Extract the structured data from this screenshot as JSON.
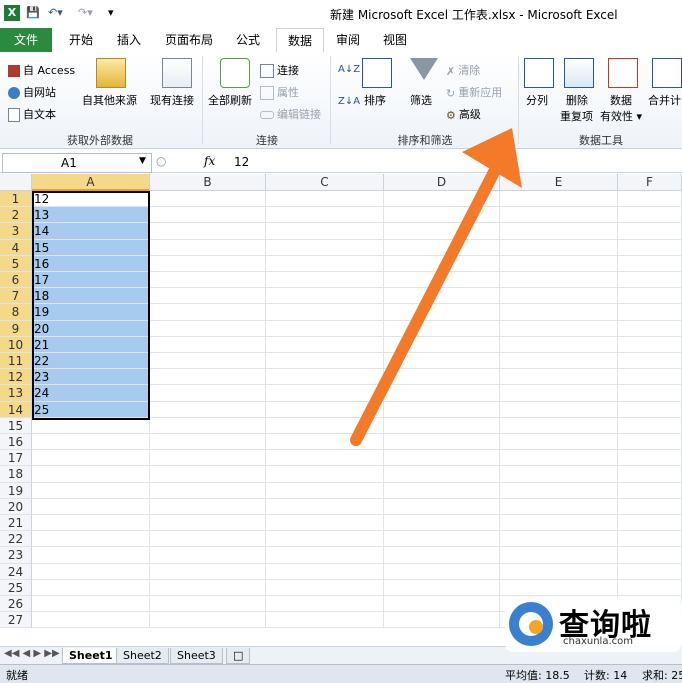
{
  "window": {
    "title": "新建 Microsoft Excel 工作表.xlsx - Microsoft Excel",
    "app_logo": "X"
  },
  "tabs": [
    {
      "label": "文件"
    },
    {
      "label": "开始"
    },
    {
      "label": "插入"
    },
    {
      "label": "页面布局"
    },
    {
      "label": "公式"
    },
    {
      "label": "数据"
    },
    {
      "label": "审阅"
    },
    {
      "label": "视图"
    }
  ],
  "ribbon": {
    "external": {
      "access": "自 Access",
      "web": "自网站",
      "text": "自文本",
      "other": "自其他来源",
      "existing": "现有连接",
      "group": "获取外部数据"
    },
    "connections": {
      "refresh": "全部刷新",
      "connect": "连接",
      "properties": "属性",
      "edit_links": "编辑链接",
      "group": "连接"
    },
    "sort": {
      "sort": "排序",
      "filter": "筛选",
      "clear": "清除",
      "reapply": "重新应用",
      "advanced": "高级",
      "group": "排序和筛选"
    },
    "tools": {
      "split": "分列",
      "remove_dup_1": "删除",
      "remove_dup_2": "重复项",
      "validation_1": "数据",
      "validation_2": "有效性",
      "consolidate": "合并计",
      "group": "数据工具"
    }
  },
  "formula_bar": {
    "name_box": "A1",
    "fx": "fx",
    "value": "12"
  },
  "columns": [
    "A",
    "B",
    "C",
    "D",
    "E",
    "F"
  ],
  "rows": [
    "1",
    "2",
    "3",
    "4",
    "5",
    "6",
    "7",
    "8",
    "9",
    "10",
    "11",
    "12",
    "13",
    "14",
    "15",
    "16",
    "17",
    "18",
    "19",
    "20",
    "21",
    "22",
    "23",
    "24",
    "25",
    "26",
    "27"
  ],
  "col_a": [
    "12",
    "13",
    "14",
    "15",
    "16",
    "17",
    "18",
    "19",
    "20",
    "21",
    "22",
    "23",
    "24",
    "25"
  ],
  "sheets": [
    "Sheet1",
    "Sheet2",
    "Sheet3"
  ],
  "status": {
    "ready": "就绪",
    "avg": "平均值: 18.5",
    "count": "计数: 14",
    "sum": "求和: 25"
  },
  "watermark": {
    "main": "查询啦",
    "sub": "chaxunla.com"
  },
  "colors": {
    "file_tab": "#2a8b3f",
    "selection": "#a7cbef",
    "header_sel": "#f5d98a",
    "arrow": "#f47a2a"
  }
}
